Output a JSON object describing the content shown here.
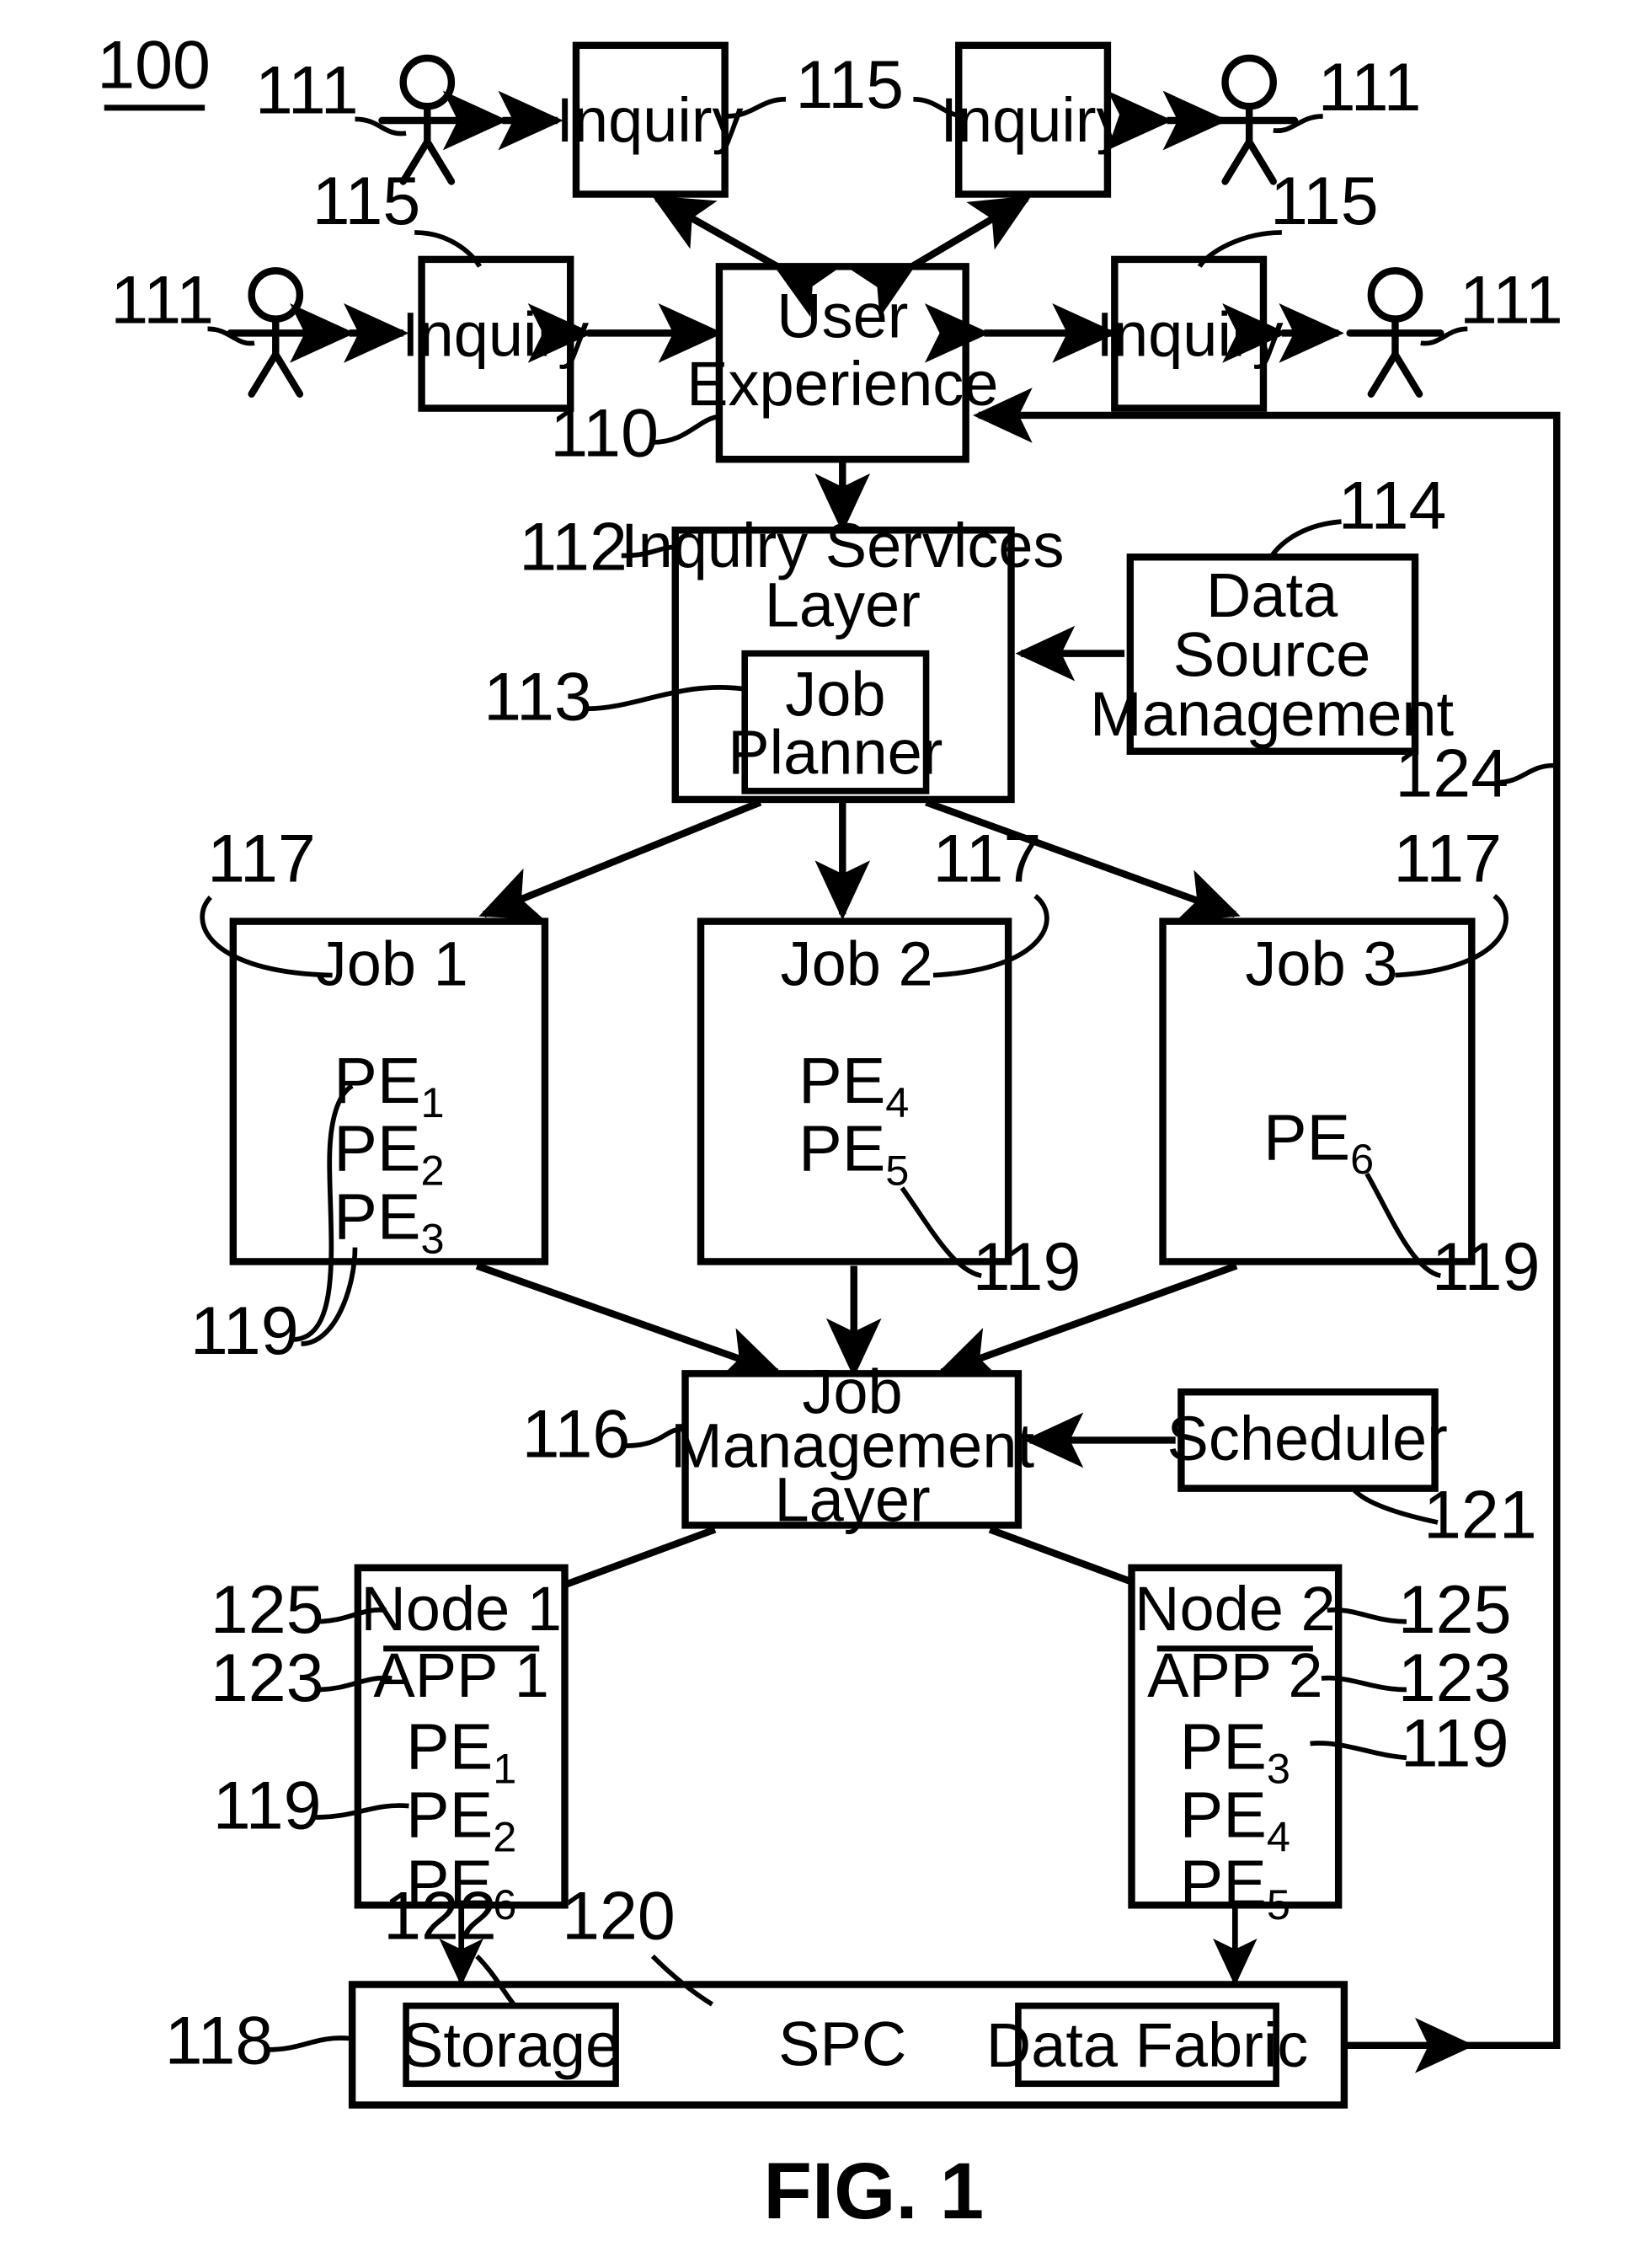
{
  "figure": {
    "number_label": "100",
    "caption": "FIG. 1"
  },
  "boxes": {
    "inquiry_tl": "Inquiry",
    "inquiry_tr": "Inquiry",
    "inquiry_ml": "Inquiry",
    "inquiry_mr": "Inquiry",
    "user_experience_line1": "User",
    "user_experience_line2": "Experience",
    "inquiry_services_line1": "Inquiry Services",
    "inquiry_services_line2": "Layer",
    "job_planner_line1": "Job",
    "job_planner_line2": "Planner",
    "data_source_line1": "Data",
    "data_source_line2": "Source",
    "data_source_line3": "Management",
    "job1_title": "Job 1",
    "job2_title": "Job 2",
    "job3_title": "Job 3",
    "job_mgmt_line1": "Job",
    "job_mgmt_line2": "Management",
    "job_mgmt_line3": "Layer",
    "scheduler": "Scheduler",
    "node1_title": "Node 1",
    "node1_app": "APP 1",
    "node2_title": "Node 2",
    "node2_app": "APP 2",
    "spc": "SPC",
    "storage": "Storage",
    "data_fabric": "Data Fabric"
  },
  "pe_labels": {
    "base": "PE",
    "job1": [
      "1",
      "2",
      "3"
    ],
    "job2": [
      "4",
      "5"
    ],
    "job3": [
      "6"
    ],
    "node1": [
      "1",
      "2",
      "6"
    ],
    "node2": [
      "3",
      "4",
      "5"
    ]
  },
  "reference_numerals": {
    "n100": "100",
    "n110": "110",
    "n111_tl": "111",
    "n111_tr": "111",
    "n111_ml": "111",
    "n111_mr": "111",
    "n112": "112",
    "n113": "113",
    "n114": "114",
    "n115_top": "115",
    "n115_left": "115",
    "n115_right": "115",
    "n116": "116",
    "n117_a": "117",
    "n117_b": "117",
    "n117_c": "117",
    "n118": "118",
    "n119_job1": "119",
    "n119_job2": "119",
    "n119_job3": "119",
    "n119_node1": "119",
    "n119_node2": "119",
    "n120": "120",
    "n121": "121",
    "n122": "122",
    "n123_left": "123",
    "n123_right": "123",
    "n124": "124",
    "n125_left": "125",
    "n125_right": "125"
  },
  "actors": {
    "count": 4,
    "icon": "stick-figure-user-icon"
  },
  "colors": {
    "stroke": "#000000",
    "fill": "#ffffff",
    "background": "#ffffff"
  }
}
